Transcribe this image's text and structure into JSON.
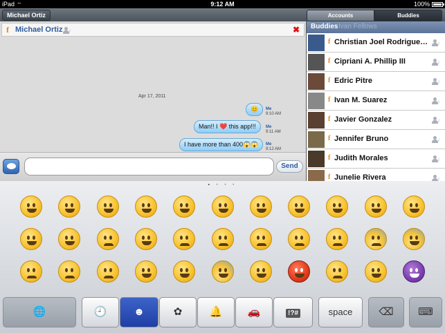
{
  "status": {
    "carrier": "iPad",
    "time": "9:12 AM",
    "battery": "100%"
  },
  "topbar": {
    "window_tab": "Michael Ortiz",
    "seg_accounts": "Accounts",
    "seg_buddies": "Buddies"
  },
  "chat": {
    "contact_name": "Michael Ortiz",
    "date": "Apr 17, 2011",
    "messages": [
      {
        "text": "😊",
        "sender": "Me",
        "time": "9:10 AM"
      },
      {
        "text": "Man!! I ❤️ this app!!!",
        "sender": "Me",
        "time": "9:11 AM"
      },
      {
        "text": "I have more than 400😱😱",
        "sender": "Me",
        "time": "9:12 AM"
      }
    ],
    "input_value": "",
    "send_label": "Send"
  },
  "buddies": {
    "header": "Buddies",
    "header_partial": "Ivan Fellows",
    "list": [
      {
        "name": "Christian Joel Rodriguez…"
      },
      {
        "name": "Cipriani A. Phillip III"
      },
      {
        "name": "Edric Pitre"
      },
      {
        "name": "Ivan M. Suarez"
      },
      {
        "name": "Javier Gonzalez"
      },
      {
        "name": "Jennifer Bruno"
      },
      {
        "name": "Judith Morales"
      },
      {
        "name": "Junelie Rivera"
      }
    ]
  },
  "keyboard": {
    "page_dots": "• • • •",
    "emoji_rows": [
      [
        "😄",
        "😊",
        "😃",
        "☺️",
        "😉",
        "😍",
        "😘",
        "😚",
        "😳",
        "😌",
        "😁"
      ],
      [
        "😜",
        "😝",
        "😒",
        "😏",
        "😓",
        "😔",
        "😞",
        "😖",
        "😥",
        "😰",
        "😨"
      ],
      [
        "😣",
        "😢",
        "😭",
        "😂",
        "😲",
        "😱",
        "😠",
        "😡",
        "😪",
        "😷",
        "👿"
      ]
    ],
    "space_label": "space",
    "symbols_label": "!?#"
  },
  "colors": {
    "accent": "#2f5b9e",
    "bubble": "#8fcdf6",
    "facebook_f": "#e8841b",
    "close": "#dd1111"
  }
}
